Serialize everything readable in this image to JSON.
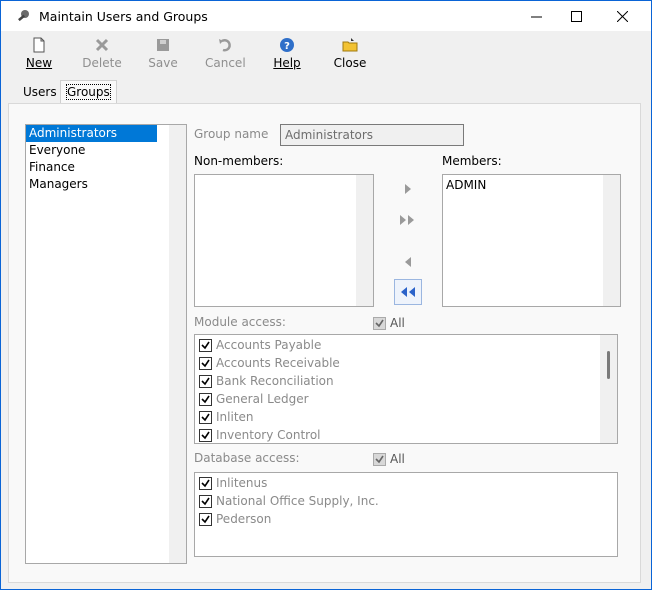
{
  "window": {
    "title": "Maintain Users and Groups"
  },
  "toolbar": {
    "new_label": "New",
    "delete_label": "Delete",
    "save_label": "Save",
    "cancel_label": "Cancel",
    "help_label": "Help",
    "close_label": "Close"
  },
  "tabs": [
    {
      "label": "Users"
    },
    {
      "label": "Groups"
    }
  ],
  "groups": {
    "items": [
      "Administrators",
      "Everyone",
      "Finance",
      "Managers"
    ],
    "selected": "Administrators"
  },
  "form": {
    "group_name_label": "Group name",
    "group_name_value": "Administrators",
    "nonmembers_label": "Non-members:",
    "members_label": "Members:",
    "members": [
      "ADMIN"
    ],
    "module_access_label": "Module access:",
    "module_all_label": "All",
    "modules": [
      "Accounts Payable",
      "Accounts Receivable",
      "Bank Reconciliation",
      "General Ledger",
      "Inliten",
      "Inventory Control"
    ],
    "database_access_label": "Database access:",
    "database_all_label": "All",
    "databases": [
      "Inlitenus",
      "National Office Supply, Inc.",
      "Pederson"
    ]
  },
  "colors": {
    "selection": "#0078d7",
    "accent_border": "#0a64d6"
  }
}
